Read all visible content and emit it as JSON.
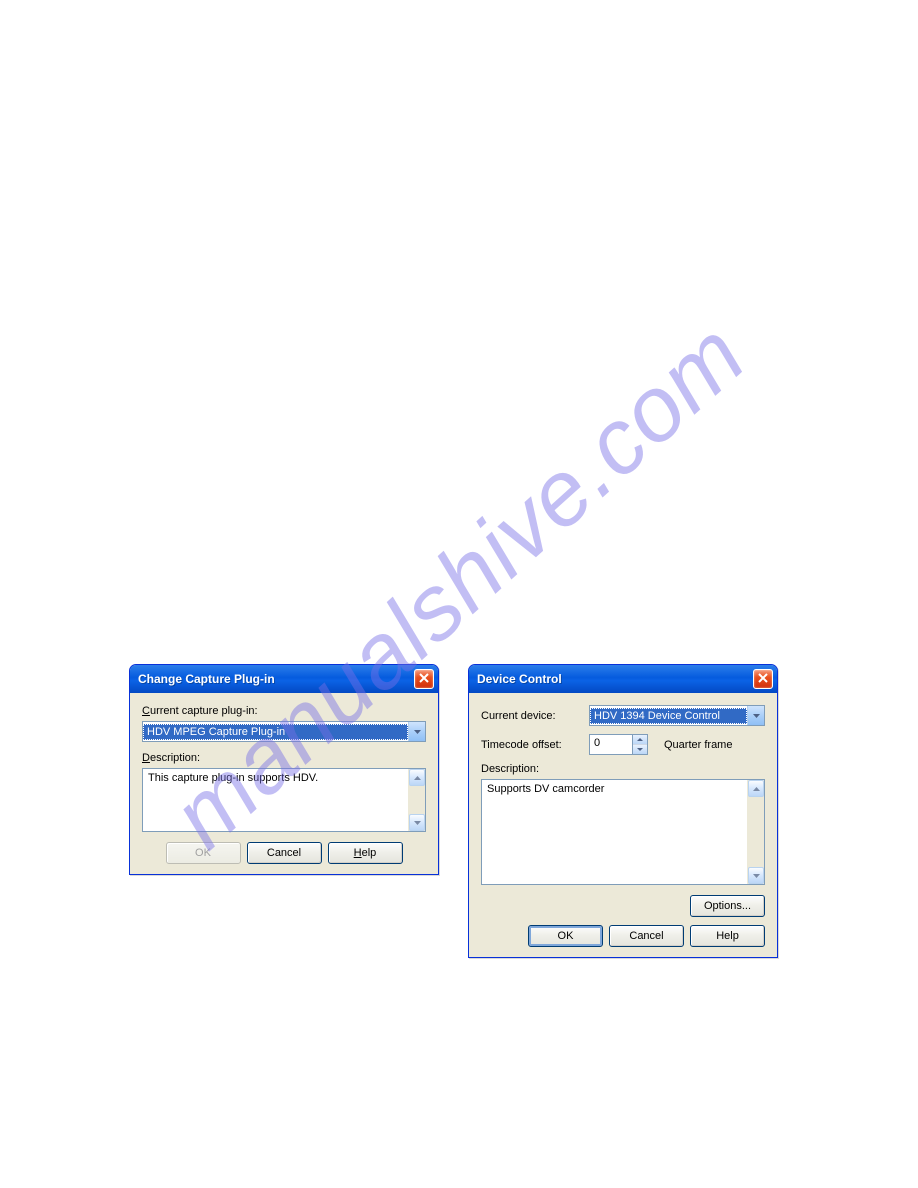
{
  "watermark": "manualshive.com",
  "dialog1": {
    "title": "Change Capture Plug-in",
    "current_label_pre": "C",
    "current_label_post": "urrent capture plug-in:",
    "combo_value": "HDV MPEG Capture Plug-in",
    "desc_label_pre": "D",
    "desc_label_post": "escription:",
    "desc_text": "This capture plug-in supports HDV.",
    "ok": "OK",
    "cancel": "Cancel",
    "help_pre": "H",
    "help_post": "elp"
  },
  "dialog2": {
    "title": "Device Control",
    "device_label": "Current device:",
    "device_value": "HDV 1394 Device Control",
    "tc_label": "Timecode offset:",
    "tc_value": "0",
    "tc_unit": "Quarter frame",
    "desc_label": "Description:",
    "desc_text": "Supports DV camcorder",
    "options": "Options...",
    "ok": "OK",
    "cancel": "Cancel",
    "help": "Help"
  }
}
